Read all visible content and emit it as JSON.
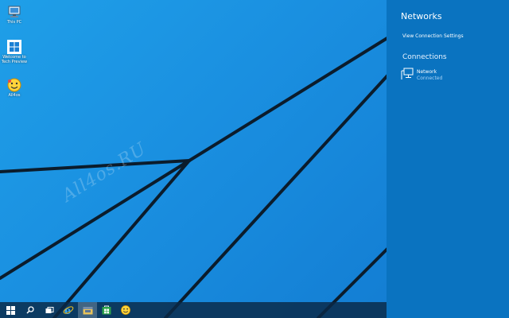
{
  "desktop": {
    "icons": [
      {
        "label": "This PC",
        "icon": "computer-icon"
      },
      {
        "label": "Welcome to Tech Preview",
        "icon": "windows-logo-icon"
      },
      {
        "label": "All4os",
        "icon": "smiley-face-icon"
      }
    ],
    "watermark": "All4os.RU"
  },
  "taskbar": {
    "items": [
      {
        "icon": "windows-start-icon"
      },
      {
        "icon": "search-icon"
      },
      {
        "icon": "task-view-icon"
      },
      {
        "icon": "internet-explorer-icon"
      },
      {
        "icon": "file-explorer-icon",
        "active": true
      },
      {
        "icon": "store-icon"
      },
      {
        "icon": "smiley-face-icon"
      }
    ]
  },
  "flyout": {
    "title": "Networks",
    "view_settings_link": "View Connection Settings",
    "connections_heading": "Connections",
    "connection": {
      "name": "Network",
      "status": "Connected",
      "icon": "wired-network-icon"
    }
  },
  "colors": {
    "wallpaper": "#1a8fe0",
    "flyout_bg": "#0a73c0",
    "taskbar_bg": "#0a2846",
    "status_text": "#a9d3f5"
  }
}
